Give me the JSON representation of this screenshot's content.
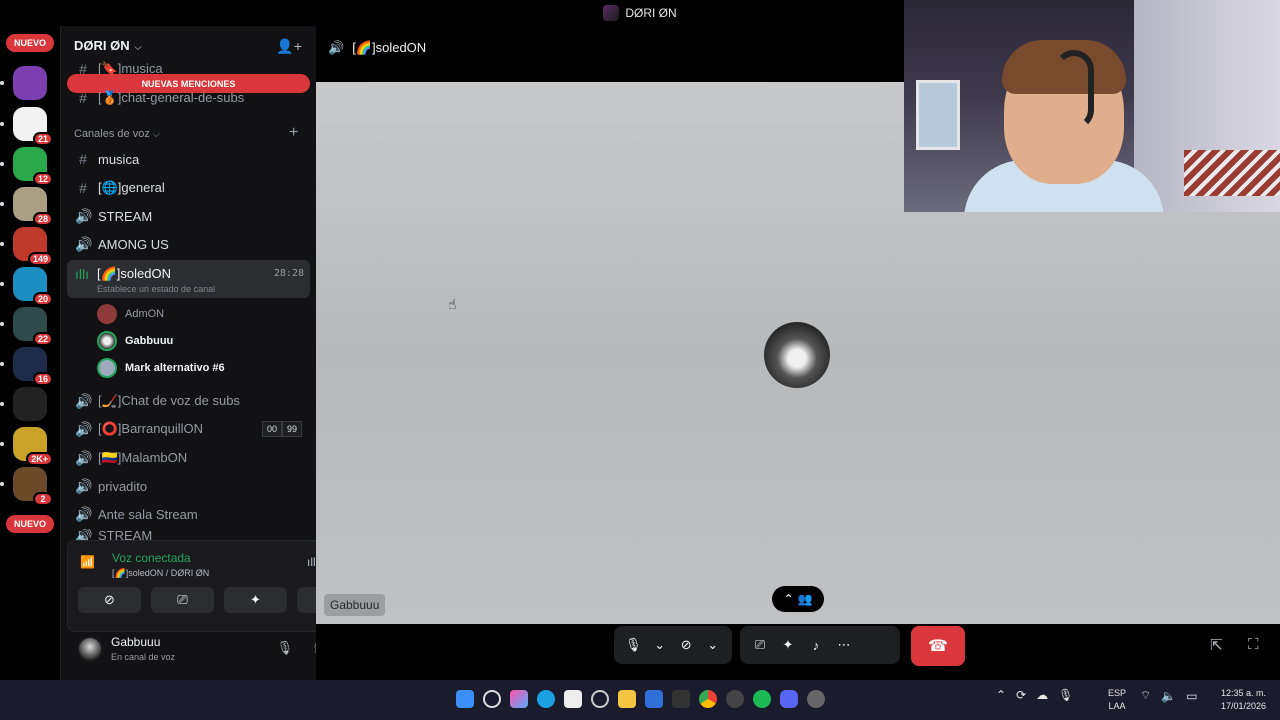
{
  "window": {
    "title": "DØRI ØN"
  },
  "rail": {
    "nuevo_top": "NUEVO",
    "nuevo_bottom": "NUEVO",
    "servers": [
      {
        "badge": "",
        "color": "#7b3fb0"
      },
      {
        "badge": "21",
        "color": "#f2f2f2"
      },
      {
        "badge": "12",
        "color": "#2aa84a"
      },
      {
        "badge": "28",
        "color": "#a99f82"
      },
      {
        "badge": "149",
        "color": "#c03a2b"
      },
      {
        "badge": "20",
        "color": "#1b8ec2"
      },
      {
        "badge": "22",
        "color": "#2e4a4a"
      },
      {
        "badge": "16",
        "color": "#1e2b4a"
      },
      {
        "badge": "",
        "color": "#222222"
      },
      {
        "badge": "2K+",
        "color": "#c9a227"
      },
      {
        "badge": "2",
        "color": "#6b4a2a"
      }
    ]
  },
  "sidebar": {
    "guild_name": "DØRI ØN",
    "mentions_banner": "NUEVAS MENCIONES",
    "top_channels": [
      {
        "icon": "#",
        "label": "[🔖]musica"
      },
      {
        "icon": "#",
        "label": "[🥉]chat-general-de-subs"
      }
    ],
    "voice_category": "Canales de voz",
    "channels": [
      {
        "icon": "#",
        "label": "musica"
      },
      {
        "icon": "#",
        "label": "[🌐]general"
      },
      {
        "icon": "🔊",
        "label": "STREAM"
      },
      {
        "icon": "🔊",
        "label": "AMONG US"
      }
    ],
    "active_channel": {
      "label": "[🌈]soledON",
      "status": "Establece un estado de canal",
      "time": "28:28"
    },
    "members": [
      {
        "name": "AdmON",
        "color": "#8e3a3a"
      },
      {
        "name": "Gabbuuu",
        "color": "#cfcfcf"
      },
      {
        "name": "Mark alternativo #6",
        "color": "#9ab"
      }
    ],
    "more_channels": [
      {
        "icon": "🔊",
        "label": "[🏒]Chat de voz de subs"
      },
      {
        "icon": "🔊",
        "label": "[⭕]BarranquillON",
        "count_a": "00",
        "count_b": "99"
      },
      {
        "icon": "🔊",
        "label": "[🇨🇴]MalambON"
      },
      {
        "icon": "🔊",
        "label": "privadito"
      },
      {
        "icon": "🔊",
        "label": "Ante sala Stream"
      },
      {
        "icon": "🔊",
        "label": "STREAM"
      }
    ]
  },
  "voice_panel": {
    "title": "Voz conectada",
    "subtitle": "[🌈]soledON / DØRI ØN"
  },
  "user_panel": {
    "name": "Gabbuuu",
    "status": "En canal de voz"
  },
  "stage": {
    "title": "[🌈]soledON",
    "participant_tag": "Gabbuuu"
  },
  "taskbar": {
    "lang": "ESP",
    "lang2": "LAA",
    "time": "12:35 a. m.",
    "date": "17/01/2026"
  }
}
